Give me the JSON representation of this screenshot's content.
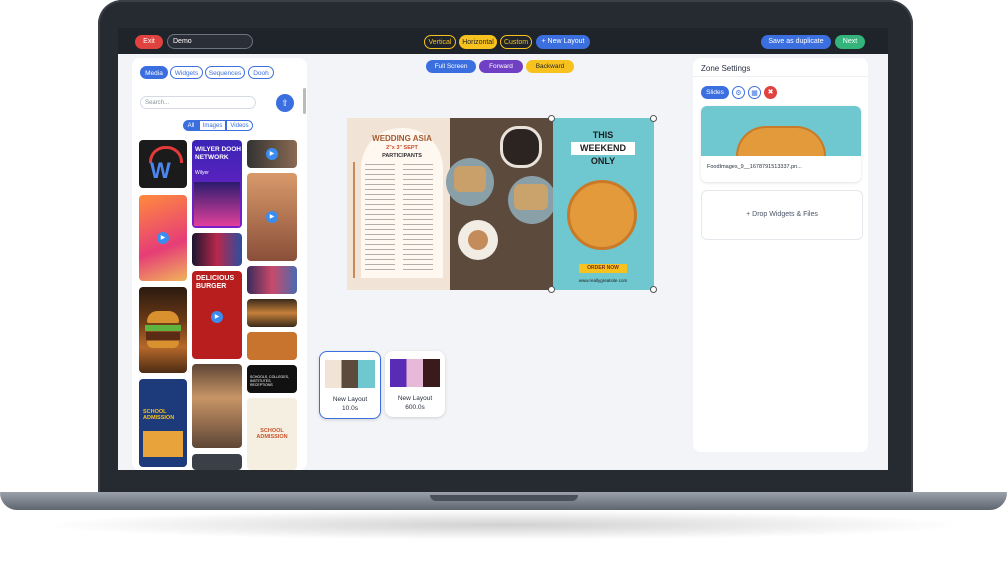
{
  "toolbar": {
    "exit_label": "Exit",
    "layout_name": "Demo",
    "orientations": [
      "Vertical",
      "Horizontal",
      "Custom"
    ],
    "active_orientation": "Horizontal",
    "new_layout_label": "+ New Layout",
    "save_duplicate_label": "Save as duplicate",
    "next_label": "Next"
  },
  "left_panel": {
    "tabs": [
      "Media",
      "Widgets",
      "Sequences",
      "Dooh"
    ],
    "active_tab": "Media",
    "search_placeholder": "Search...",
    "filters": [
      "All",
      "Images",
      "Videos"
    ],
    "active_filter": "All",
    "thumbs": {
      "wilyer_title": "WILYER DOOH NETWORK",
      "wilyer_brand": "Wilyer",
      "burger_title": "DELICIOUS BURGER",
      "school_title": "SCHOOL ADMISSION",
      "school_title2": "SCHOOL ADMISSION",
      "schools_text": "SCHOOLS, COLLEGES, INSTITUTES, RECEPTIONS"
    }
  },
  "center": {
    "controls": [
      "Full Screen",
      "Forward",
      "Backward"
    ],
    "menu": {
      "title": "WEDDING ASIA",
      "date": "2\"x 3\" SEPT",
      "subtitle": "PARTICIPANTS"
    },
    "pizza": {
      "line1": "THIS",
      "line2": "WEEKEND",
      "line3": "ONLY",
      "cta": "ORDER NOW",
      "site": "www.reallygreatsite.com"
    },
    "layouts": [
      {
        "name": "New Layout",
        "duration": "10.0s"
      },
      {
        "name": "New Layout",
        "duration": "600.0s"
      }
    ]
  },
  "right_panel": {
    "title": "Zone Settings",
    "slides_label": "Slides",
    "file_name": "FoodImages_9__1678791513337.pn...",
    "drop_label": "+ Drop Widgets & Files"
  }
}
